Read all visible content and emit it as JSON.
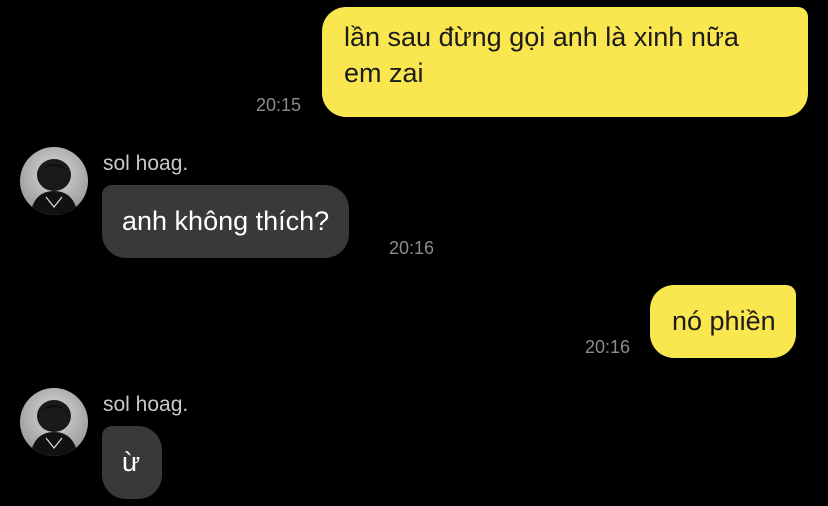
{
  "messages": [
    {
      "direction": "outgoing",
      "text_line1": "lần sau đừng gọi anh là xinh nữa",
      "text_line2": "em zai",
      "time": "20:15"
    },
    {
      "direction": "incoming",
      "sender": "sol hoag.",
      "text": "anh không thích?",
      "time": "20:16"
    },
    {
      "direction": "outgoing",
      "text": "nó phiền",
      "time": "20:16"
    },
    {
      "direction": "incoming",
      "sender": "sol hoag.",
      "text": "ừ",
      "time": ""
    }
  ],
  "colors": {
    "background": "#000000",
    "outgoing_bubble": "#fae64f",
    "incoming_bubble": "#393939",
    "timestamp": "#8b8b8b"
  },
  "icons": {
    "avatar": "profile-photo"
  }
}
